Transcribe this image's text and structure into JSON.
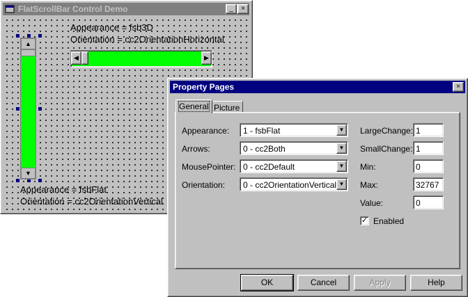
{
  "designer": {
    "title": "FlatScrollBar Control Demo",
    "caption_buttons": {
      "minimize": "_",
      "maximize": "□",
      "close": "×"
    },
    "horizontal_bar": {
      "appearance": "Appearance = fsb3D",
      "orientation": "Orientation = cc2OrientationHorizontal"
    },
    "vertical_bar": {
      "appearance": "Appearance = fsbFlat",
      "orientation": "Orientation = cc2OrientationVertical"
    },
    "scroll_arrows": {
      "up": "▲",
      "down": "▼",
      "left": "◀",
      "right": "▶"
    },
    "scroll_color": "#00ff00"
  },
  "dialog": {
    "title": "Property Pages",
    "close_glyph": "×",
    "tabs": [
      {
        "label": "General",
        "active": true
      },
      {
        "label": "Picture",
        "active": false
      }
    ],
    "combo_arrow": "▼",
    "left_fields": [
      {
        "label": "Appearance:",
        "value": "1 - fsbFlat"
      },
      {
        "label": "Arrows:",
        "value": "0 - cc2Both"
      },
      {
        "label": "MousePointer:",
        "value": "0 - cc2Default"
      },
      {
        "label": "Orientation:",
        "value": "0 - cc2OrientationVertical"
      }
    ],
    "right_fields": [
      {
        "label": "LargeChange:",
        "value": "1"
      },
      {
        "label": "SmallChange:",
        "value": "1"
      },
      {
        "label": "Min:",
        "value": "0"
      },
      {
        "label": "Max:",
        "value": "32767"
      },
      {
        "label": "Value:",
        "value": "0"
      }
    ],
    "enabled": {
      "label": "Enabled",
      "checked": true,
      "mark": "✓"
    },
    "buttons": {
      "ok": "OK",
      "cancel": "Cancel",
      "apply": "Apply",
      "help": "Help"
    }
  }
}
